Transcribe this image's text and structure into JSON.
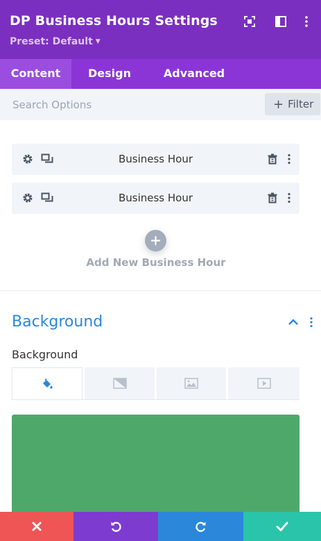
{
  "header": {
    "title": "DP Business Hours Settings",
    "preset": "Preset: Default",
    "icons": [
      "focus-expand-icon",
      "sidebar-layout-icon",
      "more-vertical-icon"
    ]
  },
  "tabs": [
    {
      "label": "Content",
      "active": true
    },
    {
      "label": "Design",
      "active": false
    },
    {
      "label": "Advanced",
      "active": false
    }
  ],
  "search": {
    "placeholder": "Search Options",
    "filter_label": "Filter"
  },
  "items": [
    {
      "label": "Business Hour"
    },
    {
      "label": "Business Hour"
    }
  ],
  "add_new": {
    "label": "Add New Business Hour"
  },
  "background_section": {
    "title": "Background",
    "field_label": "Background",
    "tabs": [
      "paint-bucket-icon",
      "gradient-icon",
      "image-icon",
      "video-icon"
    ],
    "active_tab": 0,
    "color": "#4ea86a"
  },
  "footer": {
    "buttons": [
      {
        "name": "cancel",
        "icon": "close-icon",
        "color": "#ef5555"
      },
      {
        "name": "undo",
        "icon": "undo-icon",
        "color": "#7e3bd0"
      },
      {
        "name": "redo",
        "icon": "redo-icon",
        "color": "#2b87da"
      },
      {
        "name": "save",
        "icon": "check-icon",
        "color": "#29c4a9"
      }
    ]
  },
  "colors": {
    "header": "#7b2fc0",
    "tabs": "#8b35d6",
    "accent_blue": "#2b87da"
  }
}
